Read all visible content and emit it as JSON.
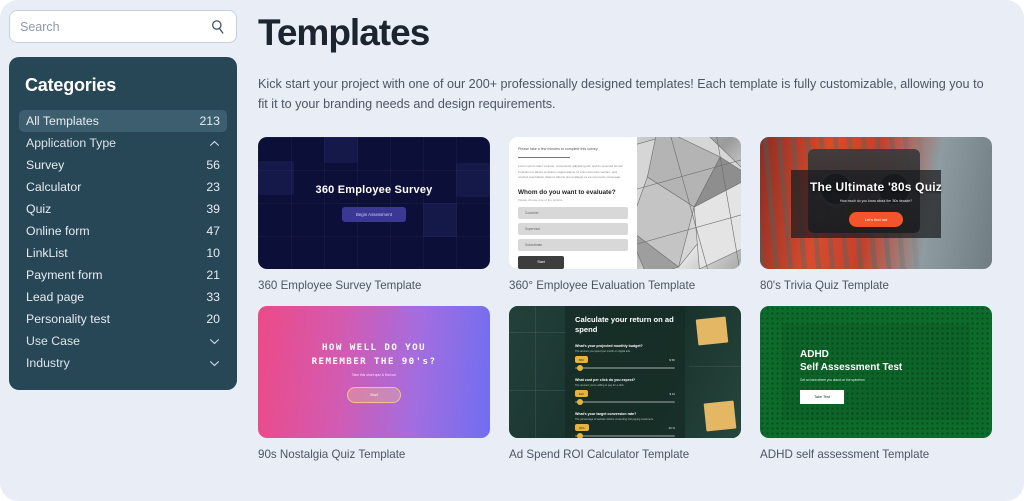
{
  "search": {
    "placeholder": "Search",
    "value": "",
    "icon": "search-icon"
  },
  "sidebar": {
    "title": "Categories",
    "items": [
      {
        "label": "All Templates",
        "count": "213",
        "type": "item",
        "active": true
      },
      {
        "label": "Application Type",
        "count": "",
        "type": "group",
        "chevron": "chevron-up-icon"
      },
      {
        "label": "Survey",
        "count": "56",
        "type": "item"
      },
      {
        "label": "Calculator",
        "count": "23",
        "type": "item"
      },
      {
        "label": "Quiz",
        "count": "39",
        "type": "item"
      },
      {
        "label": "Online form",
        "count": "47",
        "type": "item"
      },
      {
        "label": "LinkList",
        "count": "10",
        "type": "item"
      },
      {
        "label": "Payment form",
        "count": "21",
        "type": "item"
      },
      {
        "label": "Lead page",
        "count": "33",
        "type": "item"
      },
      {
        "label": "Personality test",
        "count": "20",
        "type": "item"
      },
      {
        "label": "Use Case",
        "count": "",
        "type": "group",
        "chevron": "chevron-down-icon"
      },
      {
        "label": "Industry",
        "count": "",
        "type": "group",
        "chevron": "chevron-down-icon"
      }
    ]
  },
  "header": {
    "title": "Templates",
    "description": "Kick start your project with one of our 200+ professionally designed templates! Each template is fully customizable, allowing you to fit it to your branding needs and design requirements."
  },
  "cards": [
    {
      "caption": "360 Employee Survey Template",
      "thumb": {
        "heading": "360 Employee Survey",
        "button": "Begin Assessment"
      }
    },
    {
      "caption": "360° Employee Evaluation Template",
      "thumb": {
        "intro": "Please take a few minutes to complete this survey",
        "paragraph": "Lorem ipsum dolor sit amet, consectetur adipiscing elit, sed do eiusmod tempor incididunt ut labore et dolore magna aliqua. Ut enim ad minim veniam, quis nostrud exercitation ullamco laboris nisi ut aliquip ex ea commodo consequat.",
        "question": "Whom do you want to evaluate?",
        "hint": "Please choose one of the options.",
        "options": [
          "Coworker",
          "Supervisor",
          "Subordinate"
        ],
        "button": "Start"
      }
    },
    {
      "caption": "80's Trivia Quiz Template",
      "thumb": {
        "heading": "The Ultimate '80s Quiz",
        "subheading": "How much do you know about the '80s decade?",
        "button": "Let's find out"
      }
    },
    {
      "caption": "90s Nostalgia Quiz Template",
      "thumb": {
        "heading_line1": "HOW WELL DO YOU",
        "heading_line2": "REMEMBER THE 90's?",
        "subheading": "Take this short quiz & find out",
        "button": "Start"
      }
    },
    {
      "caption": "Ad Spend ROI Calculator Template",
      "thumb": {
        "heading": "Calculate your return on ad spend",
        "questions": [
          {
            "label": "What's your projected monthly budget?",
            "hint": "The amount you spend per month on digital ads.",
            "pill": "$5K",
            "value": "$ 5K"
          },
          {
            "label": "What cost per click do you expect?",
            "hint": "The amount you're willing to pay for a click.",
            "pill": "$10",
            "value": "$ 10"
          },
          {
            "label": "What's your target conversion rate?",
            "hint": "The percentage of website visitors converting into paying customers.",
            "pill": "20%",
            "value": "20 %"
          }
        ]
      }
    },
    {
      "caption": "ADHD self assessment Template",
      "thumb": {
        "heading_line1": "ADHD",
        "heading_line2": "Self Assessment Test",
        "subheading": "Get an idea where you stand on the spectrum",
        "button": "Take Test"
      }
    }
  ],
  "colors": {
    "page_background": "#e9edf5",
    "sidebar_background": "#274656",
    "sidebar_active": "#3d5e6e",
    "title_color": "#1c2430",
    "text_color": "#4d5563"
  }
}
